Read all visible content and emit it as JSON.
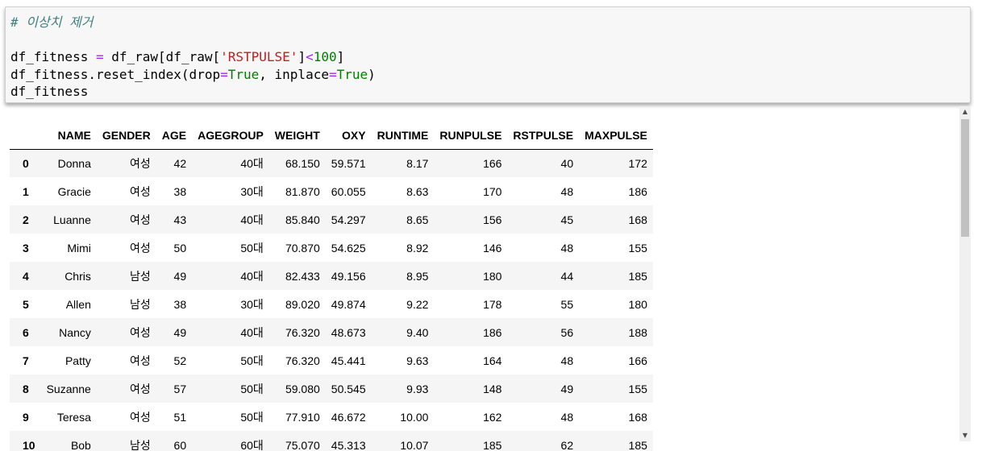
{
  "code_cell": {
    "comment": "# 이상치 제거",
    "line1": {
      "a": "df_fitness ",
      "op1": "=",
      "b": " df_raw[df_raw[",
      "str": "'RSTPULSE'",
      "c": "]",
      "op2": "<",
      "num": "100",
      "d": "]"
    },
    "line2": {
      "a": "df_fitness.reset_index(drop",
      "op1": "=",
      "kw1": "True",
      "b": ", inplace",
      "op2": "=",
      "kw2": "True",
      "c": ")"
    },
    "line3": "df_fitness"
  },
  "table": {
    "columns": [
      "NAME",
      "GENDER",
      "AGE",
      "AGEGROUP",
      "WEIGHT",
      "OXY",
      "RUNTIME",
      "RUNPULSE",
      "RSTPULSE",
      "MAXPULSE"
    ],
    "rows": [
      {
        "index": "0",
        "cells": [
          "Donna",
          "여성",
          "42",
          "40대",
          "68.150",
          "59.571",
          "8.17",
          "166",
          "40",
          "172"
        ]
      },
      {
        "index": "1",
        "cells": [
          "Gracie",
          "여성",
          "38",
          "30대",
          "81.870",
          "60.055",
          "8.63",
          "170",
          "48",
          "186"
        ]
      },
      {
        "index": "2",
        "cells": [
          "Luanne",
          "여성",
          "43",
          "40대",
          "85.840",
          "54.297",
          "8.65",
          "156",
          "45",
          "168"
        ]
      },
      {
        "index": "3",
        "cells": [
          "Mimi",
          "여성",
          "50",
          "50대",
          "70.870",
          "54.625",
          "8.92",
          "146",
          "48",
          "155"
        ]
      },
      {
        "index": "4",
        "cells": [
          "Chris",
          "남성",
          "49",
          "40대",
          "82.433",
          "49.156",
          "8.95",
          "180",
          "44",
          "185"
        ]
      },
      {
        "index": "5",
        "cells": [
          "Allen",
          "남성",
          "38",
          "30대",
          "89.020",
          "49.874",
          "9.22",
          "178",
          "55",
          "180"
        ]
      },
      {
        "index": "6",
        "cells": [
          "Nancy",
          "여성",
          "49",
          "40대",
          "76.320",
          "48.673",
          "9.40",
          "186",
          "56",
          "188"
        ]
      },
      {
        "index": "7",
        "cells": [
          "Patty",
          "여성",
          "52",
          "50대",
          "76.320",
          "45.441",
          "9.63",
          "164",
          "48",
          "166"
        ]
      },
      {
        "index": "8",
        "cells": [
          "Suzanne",
          "여성",
          "57",
          "50대",
          "59.080",
          "50.545",
          "9.93",
          "148",
          "49",
          "155"
        ]
      },
      {
        "index": "9",
        "cells": [
          "Teresa",
          "여성",
          "51",
          "50대",
          "77.910",
          "46.672",
          "10.00",
          "162",
          "48",
          "168"
        ]
      },
      {
        "index": "10",
        "cells": [
          "Bob",
          "남성",
          "60",
          "60대",
          "75.070",
          "45.313",
          "10.07",
          "185",
          "62",
          "185"
        ]
      }
    ]
  },
  "scrollbar": {
    "up_icon": "▲",
    "down_icon": "▼"
  }
}
